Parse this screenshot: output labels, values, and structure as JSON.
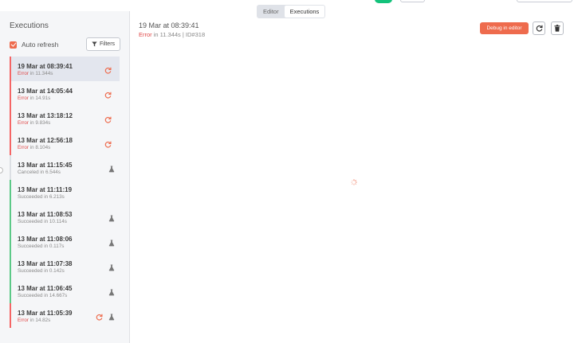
{
  "header": {
    "tabs": [
      {
        "label": "Editor",
        "active": false
      },
      {
        "label": "Executions",
        "active": true
      }
    ]
  },
  "sidebar": {
    "title": "Executions",
    "auto_refresh": {
      "label": "Auto refresh",
      "checked": true
    },
    "filters_label": "Filters",
    "items": [
      {
        "time": "19 Mar at 08:39:41",
        "status": "Error",
        "duration": " in 11.344s",
        "retry": true,
        "flask": false,
        "selected": true,
        "kind": "error"
      },
      {
        "time": "13 Mar at 14:05:44",
        "status": "Error",
        "duration": " in 14.91s",
        "retry": true,
        "flask": false,
        "selected": false,
        "kind": "error"
      },
      {
        "time": "13 Mar at 13:18:12",
        "status": "Error",
        "duration": " in 9.834s",
        "retry": true,
        "flask": false,
        "selected": false,
        "kind": "error"
      },
      {
        "time": "13 Mar at 12:56:18",
        "status": "Error",
        "duration": " in 8.104s",
        "retry": true,
        "flask": false,
        "selected": false,
        "kind": "error"
      },
      {
        "time": "13 Mar at 11:15:45",
        "status": "Canceled",
        "duration": " in 6.544s",
        "retry": false,
        "flask": true,
        "selected": false,
        "kind": "canceled"
      },
      {
        "time": "13 Mar at 11:11:19",
        "status": "Succeeded",
        "duration": " in 6.213s",
        "retry": false,
        "flask": false,
        "selected": false,
        "kind": "success"
      },
      {
        "time": "13 Mar at 11:08:53",
        "status": "Succeeded",
        "duration": " in 10.114s",
        "retry": false,
        "flask": true,
        "selected": false,
        "kind": "success"
      },
      {
        "time": "13 Mar at 11:08:06",
        "status": "Succeeded",
        "duration": " in 0.117s",
        "retry": false,
        "flask": true,
        "selected": false,
        "kind": "success"
      },
      {
        "time": "13 Mar at 11:07:38",
        "status": "Succeeded",
        "duration": " in 0.142s",
        "retry": false,
        "flask": true,
        "selected": false,
        "kind": "success"
      },
      {
        "time": "13 Mar at 11:06:45",
        "status": "Succeeded",
        "duration": " in 14.667s",
        "retry": false,
        "flask": true,
        "selected": false,
        "kind": "success"
      },
      {
        "time": "13 Mar at 11:05:39",
        "status": "Error",
        "duration": " in 14.82s",
        "retry": true,
        "flask": true,
        "selected": false,
        "kind": "error"
      }
    ]
  },
  "main": {
    "time": "19 Mar at 08:39:41",
    "status": "Error",
    "detail": " in 11.344s | ID#318",
    "debug_label": "Debug in editor"
  },
  "colors": {
    "accent": "#ee6b4d",
    "error": "#f56565",
    "success": "#5cc987",
    "toggle": "#13c27b"
  }
}
